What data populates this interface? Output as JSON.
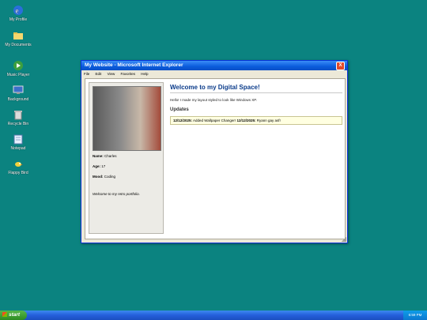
{
  "desktop": {
    "icons": [
      {
        "label": "My Profile",
        "icon": "ie-globe-icon"
      },
      {
        "label": "My Documents",
        "icon": "folder-icon"
      },
      {
        "label": "Music Player",
        "icon": "media-player-icon"
      },
      {
        "label": "Background",
        "icon": "display-icon"
      },
      {
        "label": "Recycle Bin",
        "icon": "recycle-bin-icon"
      },
      {
        "label": "Notepad",
        "icon": "notepad-icon"
      },
      {
        "label": "Flappy Bird",
        "icon": "bird-icon"
      }
    ]
  },
  "window": {
    "title": "My Website - Microsoft Internet Explorer",
    "close_label": "X",
    "menu": [
      "File",
      "Edit",
      "View",
      "Favorites",
      "Help"
    ]
  },
  "profile": {
    "name_label": "Name:",
    "name": "Charles",
    "age_label": "Age:",
    "age": "17",
    "mood_label": "Mood:",
    "mood": "Coding",
    "intro": "Welcome to my retro portfolio."
  },
  "main": {
    "heading": "Welcome to my Digital Space!",
    "hello": "Hello! I made my layout styled to look like Windows XP.",
    "updates_heading": "Updates",
    "updates": [
      {
        "date": "12/12/2025:",
        "text": "Added Wallpaper Changer!"
      },
      {
        "date": "12/12/2025:",
        "text": "Ryann gay asf!"
      }
    ]
  },
  "taskbar": {
    "start_label": "start",
    "time": "6:59 PM"
  },
  "colors": {
    "desktop": "#0b8380",
    "title_bar": "#0a5bdc",
    "heading": "#0a3b8a",
    "update_box": "#ffffe1",
    "start_button": "#2d8a22"
  }
}
